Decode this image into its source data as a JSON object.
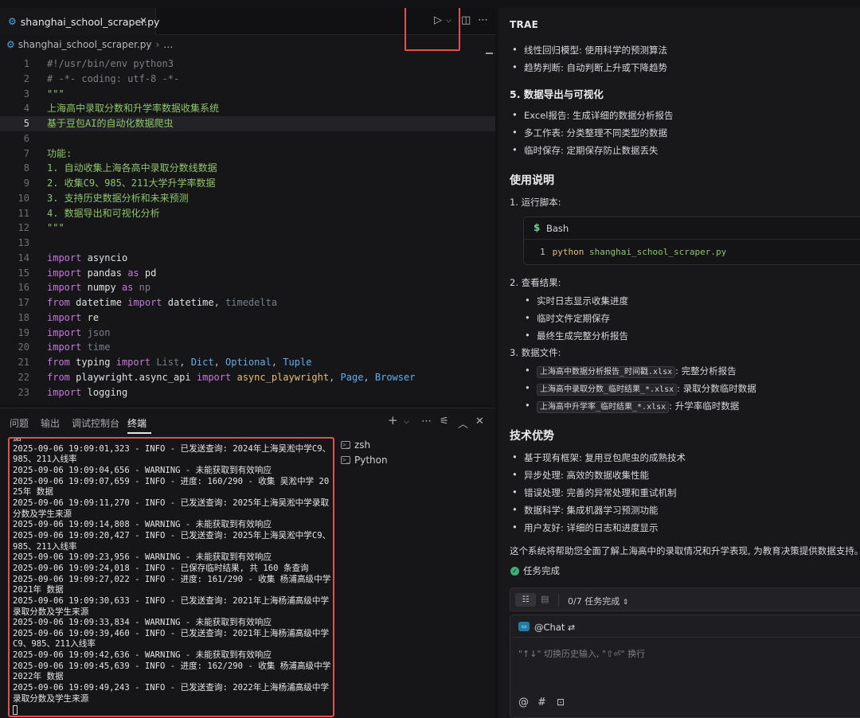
{
  "editor": {
    "tab_title": "shanghai_school_scraper.py",
    "breadcrumb_file": "shanghai_school_scraper.py",
    "breadcrumb_more": "…",
    "lines": [
      {
        "n": "1",
        "tokens": [
          {
            "c": "cm",
            "t": "#!/usr/bin/env python3"
          }
        ]
      },
      {
        "n": "2",
        "tokens": [
          {
            "c": "cm",
            "t": "# -*- coding: utf-8 -*-"
          }
        ]
      },
      {
        "n": "3",
        "tokens": [
          {
            "c": "str",
            "t": "\"\"\""
          }
        ]
      },
      {
        "n": "4",
        "tokens": [
          {
            "c": "str",
            "t": "上海高中录取分数和升学率数据收集系统"
          }
        ]
      },
      {
        "n": "5",
        "tokens": [
          {
            "c": "str",
            "t": "基于豆包AI的自动化数据爬虫"
          }
        ]
      },
      {
        "n": "6",
        "tokens": []
      },
      {
        "n": "7",
        "tokens": [
          {
            "c": "str",
            "t": "功能:"
          }
        ]
      },
      {
        "n": "8",
        "tokens": [
          {
            "c": "str",
            "t": "1. 自动收集上海各高中录取分数线数据"
          }
        ]
      },
      {
        "n": "9",
        "tokens": [
          {
            "c": "str",
            "t": "2. 收集C9、985、211大学升学率数据"
          }
        ]
      },
      {
        "n": "10",
        "tokens": [
          {
            "c": "str",
            "t": "3. 支持历史数据分析和未来预测"
          }
        ]
      },
      {
        "n": "11",
        "tokens": [
          {
            "c": "str",
            "t": "4. 数据导出和可视化分析"
          }
        ]
      },
      {
        "n": "12",
        "tokens": [
          {
            "c": "str",
            "t": "\"\"\""
          }
        ]
      },
      {
        "n": "13",
        "tokens": []
      },
      {
        "n": "14",
        "tokens": [
          {
            "c": "kw",
            "t": "import"
          },
          {
            "c": "pl",
            "t": " "
          },
          {
            "c": "mod",
            "t": "asyncio"
          }
        ]
      },
      {
        "n": "15",
        "tokens": [
          {
            "c": "kw",
            "t": "import"
          },
          {
            "c": "pl",
            "t": " "
          },
          {
            "c": "mod",
            "t": "pandas"
          },
          {
            "c": "pl",
            "t": " "
          },
          {
            "c": "kw",
            "t": "as"
          },
          {
            "c": "pl",
            "t": " "
          },
          {
            "c": "mod",
            "t": "pd"
          }
        ]
      },
      {
        "n": "16",
        "tokens": [
          {
            "c": "kw",
            "t": "import"
          },
          {
            "c": "pl",
            "t": " "
          },
          {
            "c": "mod",
            "t": "numpy"
          },
          {
            "c": "pl",
            "t": " "
          },
          {
            "c": "kw",
            "t": "as"
          },
          {
            "c": "pl",
            "t": " "
          },
          {
            "c": "dim",
            "t": "np"
          }
        ]
      },
      {
        "n": "17",
        "tokens": [
          {
            "c": "kw",
            "t": "from"
          },
          {
            "c": "pl",
            "t": " "
          },
          {
            "c": "mod",
            "t": "datetime"
          },
          {
            "c": "pl",
            "t": " "
          },
          {
            "c": "kw",
            "t": "import"
          },
          {
            "c": "pl",
            "t": " "
          },
          {
            "c": "mod",
            "t": "datetime"
          },
          {
            "c": "pl",
            "t": ", "
          },
          {
            "c": "dim",
            "t": "timedelta"
          }
        ]
      },
      {
        "n": "18",
        "tokens": [
          {
            "c": "kw",
            "t": "import"
          },
          {
            "c": "pl",
            "t": " "
          },
          {
            "c": "mod",
            "t": "re"
          }
        ]
      },
      {
        "n": "19",
        "tokens": [
          {
            "c": "kw",
            "t": "import"
          },
          {
            "c": "pl",
            "t": " "
          },
          {
            "c": "dim",
            "t": "json"
          }
        ]
      },
      {
        "n": "20",
        "tokens": [
          {
            "c": "kw",
            "t": "import"
          },
          {
            "c": "pl",
            "t": " "
          },
          {
            "c": "dim",
            "t": "time"
          }
        ]
      },
      {
        "n": "21",
        "tokens": [
          {
            "c": "kw",
            "t": "from"
          },
          {
            "c": "pl",
            "t": " "
          },
          {
            "c": "mod",
            "t": "typing"
          },
          {
            "c": "pl",
            "t": " "
          },
          {
            "c": "kw",
            "t": "import"
          },
          {
            "c": "pl",
            "t": " "
          },
          {
            "c": "dim",
            "t": "List"
          },
          {
            "c": "pl",
            "t": ", "
          },
          {
            "c": "id",
            "t": "Dict"
          },
          {
            "c": "pl",
            "t": ", "
          },
          {
            "c": "id",
            "t": "Optional"
          },
          {
            "c": "pl",
            "t": ", "
          },
          {
            "c": "id",
            "t": "Tuple"
          }
        ]
      },
      {
        "n": "22",
        "tokens": [
          {
            "c": "kw",
            "t": "from"
          },
          {
            "c": "pl",
            "t": " "
          },
          {
            "c": "mod",
            "t": "playwright.async_api"
          },
          {
            "c": "pl",
            "t": " "
          },
          {
            "c": "kw",
            "t": "import"
          },
          {
            "c": "pl",
            "t": " "
          },
          {
            "c": "fn",
            "t": "async_playwright"
          },
          {
            "c": "pl",
            "t": ", "
          },
          {
            "c": "id",
            "t": "Page"
          },
          {
            "c": "pl",
            "t": ", "
          },
          {
            "c": "id",
            "t": "Browser"
          }
        ]
      },
      {
        "n": "23",
        "tokens": [
          {
            "c": "kw",
            "t": "import"
          },
          {
            "c": "pl",
            "t": " "
          },
          {
            "c": "mod",
            "t": "logging"
          }
        ]
      }
    ]
  },
  "panel": {
    "tabs": [
      "问题",
      "输出",
      "调试控制台",
      "终端"
    ],
    "terminals": [
      "zsh",
      "Python"
    ],
    "log_lines": [
      "据",
      "2025-09-06 19:09:01,323 - INFO - 已发送查询: 2024年上海吴淞中学C9、985、211入线率",
      "2025-09-06 19:09:04,656 - WARNING - 未能获取到有效响应",
      "2025-09-06 19:09:07,659 - INFO - 进度: 160/290 - 收集 吴淞中学 2025年 数据",
      "2025-09-06 19:09:11,270 - INFO - 已发送查询: 2025年上海吴淞中学录取分数及学生来源",
      "2025-09-06 19:09:14,808 - WARNING - 未能获取到有效响应",
      "2025-09-06 19:09:20,427 - INFO - 已发送查询: 2025年上海吴淞中学C9、985、211入线率",
      "2025-09-06 19:09:23,956 - WARNING - 未能获取到有效响应",
      "2025-09-06 19:09:24,018 - INFO - 已保存临时结果, 共 160 条查询",
      "2025-09-06 19:09:27,022 - INFO - 进度: 161/290 - 收集 杨浦高级中学 2021年 数据",
      "2025-09-06 19:09:30,633 - INFO - 已发送查询: 2021年上海杨浦高级中学录取分数及学生来源",
      "2025-09-06 19:09:33,834 - WARNING - 未能获取到有效响应",
      "2025-09-06 19:09:39,460 - INFO - 已发送查询: 2021年上海杨浦高级中学C9、985、211入线率",
      "2025-09-06 19:09:42,636 - WARNING - 未能获取到有效响应",
      "2025-09-06 19:09:45,639 - INFO - 进度: 162/290 - 收集 杨浦高级中学 2022年 数据",
      "2025-09-06 19:09:49,243 - INFO - 已发送查询: 2022年上海杨浦高级中学录取分数及学生来源"
    ]
  },
  "chat": {
    "title": "TRAE",
    "b1": {
      "label": "线性回归模型",
      "text": ": 使用科学的预测算法"
    },
    "b2": {
      "label": "趋势判断",
      "text": ": 自动判断上升或下降趋势"
    },
    "h_export": "5. 数据导出与可视化",
    "b3": {
      "label": "Excel报告",
      "text": ": 生成详细的数据分析报告"
    },
    "b4": {
      "label": "多工作表",
      "text": ": 分类整理不同类型的数据"
    },
    "b5": {
      "label": "临时保存",
      "text": ": 定期保存防止数据丢失"
    },
    "h_usage": "使用说明",
    "step1": "1. 运行脚本:",
    "bash_label": "Bash",
    "bash_line_no": "1",
    "bash_cmd": "python",
    "bash_arg": "shanghai_school_scraper.py",
    "step2": "2. 查看结果:",
    "r1": "实时日志显示收集进度",
    "r2": "临时文件定期保存",
    "r3": "最终生成完整分析报告",
    "step3": "3. 数据文件:",
    "f1": {
      "file": "上海高中数据分析报告_时间戳.xlsx",
      "text": ": 完整分析报告"
    },
    "f2": {
      "file": "上海高中录取分数_临时结果_*.xlsx",
      "text": ": 录取分数临时数据"
    },
    "f3": {
      "file": "上海高中升学率_临时结果_*.xlsx",
      "text": ": 升学率临时数据"
    },
    "h_adv": "技术优势",
    "a1": {
      "label": "基于现有框架",
      "text": ": 复用豆包爬虫的成熟技术"
    },
    "a2": {
      "label": "异步处理",
      "text": ": 高效的数据收集性能"
    },
    "a3": {
      "label": "错误处理",
      "text": ": 完善的异常处理和重试机制"
    },
    "a4": {
      "label": "数据科学",
      "text": ": 集成机器学习预测功能"
    },
    "a5": {
      "label": "用户友好",
      "text": ": 详细的日志和进度显示"
    },
    "summary": "这个系统将帮助您全面了解上海高中的录取情况和升学表现, 为教育决策提供数据支持。",
    "done": "任务完成",
    "task_progress": "0/7 任务完成",
    "chat_mention": "@Chat",
    "input_placeholder": "\"↑↓\" 切换历史输入, \"⇧⏎\" 换行"
  }
}
